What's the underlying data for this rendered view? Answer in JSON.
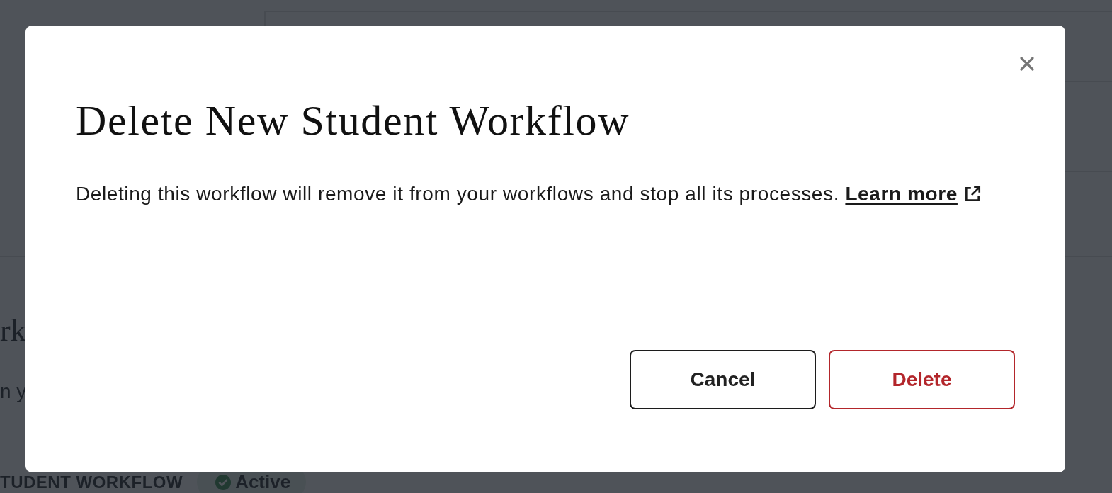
{
  "background": {
    "heading": "rk",
    "subtitle": "n y",
    "workflow_label": "TUDENT WORKFLOW",
    "status_badge": {
      "label": "Active"
    }
  },
  "dialog": {
    "title": "Delete New Student Workflow",
    "message": "Deleting this workflow will remove it from your workflows and stop all its processes.",
    "link": "Learn more",
    "buttons": [
      {
        "label": "Cancel",
        "kind": "secondary"
      },
      {
        "label": "Delete",
        "kind": "danger"
      }
    ]
  }
}
